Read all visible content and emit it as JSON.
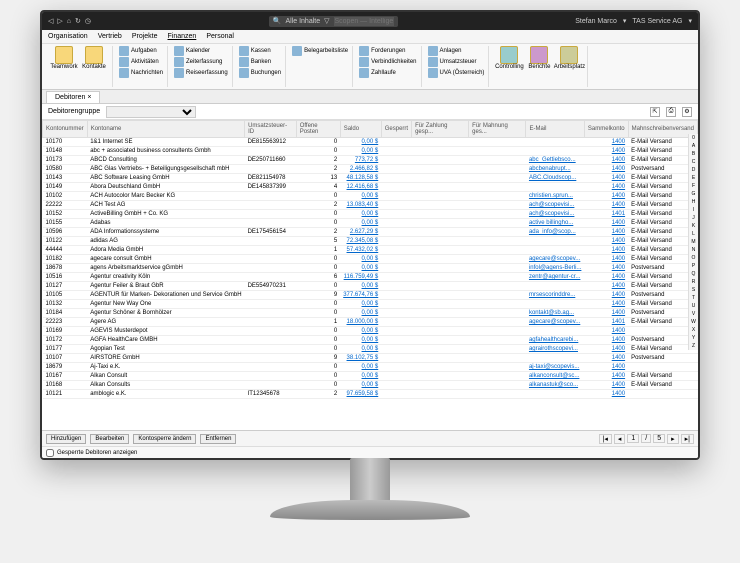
{
  "titlebar": {
    "search_prefix": "Alle Inhalte",
    "search_label": "Scopen — Intelligentes Suchfeld",
    "user": "Stefan Marco",
    "company": "TAS Service AG"
  },
  "menu": {
    "items": [
      "Organisation",
      "Vertrieb",
      "Projekte",
      "Finanzen",
      "Personal"
    ]
  },
  "ribbon": {
    "g1": {
      "big": [
        {
          "l": "Teamwork"
        },
        {
          "l": "Kontakte"
        }
      ],
      "small": [
        {
          "l": "Aufgaben"
        },
        {
          "l": "Aktivitäten"
        },
        {
          "l": "Nachrichten"
        }
      ]
    },
    "g2": {
      "small": [
        {
          "l": "Kalender"
        },
        {
          "l": "Zeiterfassung"
        },
        {
          "l": "Reiseerfassung"
        }
      ]
    },
    "g3": {
      "small": [
        {
          "l": "Kassen"
        },
        {
          "l": "Banken"
        },
        {
          "l": "Buchungen"
        }
      ]
    },
    "g4": {
      "small": [
        {
          "l": "Belegarbeitsliste"
        }
      ]
    },
    "g5": {
      "small": [
        {
          "l": "Forderungen"
        },
        {
          "l": "Verbindlichkeiten"
        },
        {
          "l": "Zahllaufe"
        }
      ]
    },
    "g6": {
      "small": [
        {
          "l": "Anlagen"
        },
        {
          "l": "Umsatzsteuer"
        },
        {
          "l": "UVA (Österreich)"
        }
      ]
    },
    "g7": {
      "big": [
        {
          "l": "Controlling"
        },
        {
          "l": "Berichte"
        },
        {
          "l": "Arbeitsplatz"
        }
      ]
    }
  },
  "tab_label": "Debitoren",
  "filter": {
    "label": "Debitorengruppe"
  },
  "columns": [
    "Kontonummer",
    "Kontoname",
    "Umsatzsteuer-ID",
    "Offene Posten",
    "Saldo",
    "Gesperrt",
    "Für Zahlung gesp...",
    "Für Mahnung ges...",
    "E-Mail",
    "Sammelkonto",
    "Mahnschreibenversand"
  ],
  "rows": [
    {
      "n": "10170",
      "name": "1&1 Internet SE",
      "vat": "DE815563912",
      "op": "0",
      "saldo": "0,00 $",
      "email": "",
      "sk": "1400",
      "mv": "E-Mail Versand"
    },
    {
      "n": "10148",
      "name": "abc + associated business consultents Gmbh",
      "vat": "",
      "op": "0",
      "saldo": "0,00 $",
      "email": "",
      "sk": "1400",
      "mv": "E-Mail Versand"
    },
    {
      "n": "10173",
      "name": "ABCD Consulting",
      "vat": "DE250711660",
      "op": "2",
      "saldo": "773,72 $",
      "email": "abc_Gettiebsco...",
      "sk": "1400",
      "mv": "E-Mail Versand"
    },
    {
      "n": "10580",
      "name": "ABC Glas Vertriebs- + Beteiligungsgesellschaft mbH",
      "vat": "",
      "op": "2",
      "saldo": "2.466,82 $",
      "email": "abcbenabrupt...",
      "sk": "1400",
      "mv": "Postversand"
    },
    {
      "n": "10143",
      "name": "ABC Software Leasing GmbH",
      "vat": "DE821154978",
      "op": "13",
      "saldo": "48.128,58 $",
      "email": "ABC.Cloudscop...",
      "sk": "1400",
      "mv": "E-Mail Versand"
    },
    {
      "n": "10149",
      "name": "Abora Deutschland GmbH",
      "vat": "DE145837399",
      "op": "4",
      "saldo": "12.416,68 $",
      "email": "",
      "sk": "1400",
      "mv": "E-Mail Versand"
    },
    {
      "n": "10102",
      "name": "ACH Autocolor Marc Becker KG",
      "vat": "",
      "op": "0",
      "saldo": "0,00 $",
      "email": "christien.sprun...",
      "sk": "1400",
      "mv": "E-Mail Versand"
    },
    {
      "n": "22222",
      "name": "ACH Test AG",
      "vat": "",
      "op": "2",
      "saldo": "13.083,40 $",
      "email": "ach@scopevisi...",
      "sk": "1400",
      "mv": "E-Mail Versand"
    },
    {
      "n": "10152",
      "name": "ActiveBilling GmbH + Co. KG",
      "vat": "",
      "op": "0",
      "saldo": "0,00 $",
      "email": "ach@scopevisi...",
      "sk": "1401",
      "mv": "E-Mail Versand"
    },
    {
      "n": "10155",
      "name": "Adabas",
      "vat": "",
      "op": "0",
      "saldo": "0,00 $",
      "email": "active billingho...",
      "sk": "1400",
      "mv": "E-Mail Versand"
    },
    {
      "n": "10596",
      "name": "ADA Informationssysteme",
      "vat": "DE175456154",
      "op": "2",
      "saldo": "2.627,29 $",
      "email": "ada_info@scop...",
      "sk": "1400",
      "mv": "E-Mail Versand"
    },
    {
      "n": "10122",
      "name": "adidas AG",
      "vat": "",
      "op": "5",
      "saldo": "72.345,08 $",
      "email": "",
      "sk": "1400",
      "mv": "E-Mail Versand"
    },
    {
      "n": "44444",
      "name": "Adora Media GmbH",
      "vat": "",
      "op": "1",
      "saldo": "57.432,02 $",
      "email": "",
      "sk": "1400",
      "mv": "E-Mail Versand"
    },
    {
      "n": "10182",
      "name": "agecare consult GmbH",
      "vat": "",
      "op": "0",
      "saldo": "0,00 $",
      "email": "agecare@scopev...",
      "sk": "1400",
      "mv": "E-Mail Versand"
    },
    {
      "n": "18678",
      "name": "agens Arbeitsmarktservice gGmbH",
      "vat": "",
      "op": "0",
      "saldo": "0,00 $",
      "email": "infol@agens-Berli...",
      "sk": "1400",
      "mv": "Postversand"
    },
    {
      "n": "10516",
      "name": "Agentur creativity Köln",
      "vat": "",
      "op": "6",
      "saldo": "116.759,49 $",
      "email": "zentr@agentur-cr...",
      "sk": "1400",
      "mv": "E-Mail Versand"
    },
    {
      "n": "10127",
      "name": "Agentur Feiler & Braut GbR",
      "vat": "DE554970231",
      "op": "0",
      "saldo": "0,00 $",
      "email": "",
      "sk": "1400",
      "mv": "E-Mail Versand"
    },
    {
      "n": "10105",
      "name": "AGENTUR für Marken- Dekorationen und Service GmbH",
      "vat": "",
      "op": "9",
      "saldo": "377.674,76 $",
      "email": "mrsescorinddre...",
      "sk": "1400",
      "mv": "Postversand"
    },
    {
      "n": "10132",
      "name": "Agentur New Way One",
      "vat": "",
      "op": "0",
      "saldo": "0,00 $",
      "email": "",
      "sk": "1400",
      "mv": "E-Mail Versand"
    },
    {
      "n": "10184",
      "name": "Agentur Schöner & Bornhölzer",
      "vat": "",
      "op": "0",
      "saldo": "0,00 $",
      "email": "kontakt@sb.ag...",
      "sk": "1400",
      "mv": "Postversand"
    },
    {
      "n": "22223",
      "name": "Agere AG",
      "vat": "",
      "op": "1",
      "saldo": "18.000,00 $",
      "email": "agecare@scopev...",
      "sk": "1401",
      "mv": "E-Mail Versand"
    },
    {
      "n": "10169",
      "name": "AGEVIS Musterdepot",
      "vat": "",
      "op": "0",
      "saldo": "0,00 $",
      "email": "",
      "sk": "1400",
      "mv": ""
    },
    {
      "n": "10172",
      "name": "AGFA HealthCare GMBH",
      "vat": "",
      "op": "0",
      "saldo": "0,00 $",
      "email": "agfahealthcarebi...",
      "sk": "1400",
      "mv": "Postversand"
    },
    {
      "n": "10177",
      "name": "Agopian Test",
      "vat": "",
      "op": "0",
      "saldo": "0,00 $",
      "email": "agrairothscopevi...",
      "sk": "1400",
      "mv": "E-Mail Versand"
    },
    {
      "n": "10107",
      "name": "AIRSTORE GmbH",
      "vat": "",
      "op": "9",
      "saldo": "38.102,75 $",
      "email": "",
      "sk": "1400",
      "mv": "Postversand"
    },
    {
      "n": "18679",
      "name": "Aj-Taxi e.K.",
      "vat": "",
      "op": "0",
      "saldo": "0,00 $",
      "email": "aj-taxi@scopevis...",
      "sk": "1400",
      "mv": ""
    },
    {
      "n": "10167",
      "name": "Alkan Consult",
      "vat": "",
      "op": "0",
      "saldo": "0,00 $",
      "email": "alkanconsult@sc...",
      "sk": "1400",
      "mv": "E-Mail Versand"
    },
    {
      "n": "10168",
      "name": "Alkan Consults",
      "vat": "",
      "op": "0",
      "saldo": "0,00 $",
      "email": "alkanastuk@sco...",
      "sk": "1400",
      "mv": "E-Mail Versand"
    },
    {
      "n": "10121",
      "name": "amblogic e.K.",
      "vat": "IT12345678",
      "op": "2",
      "saldo": "97.659,58 $",
      "email": "",
      "sk": "1400",
      "mv": ""
    }
  ],
  "alpha": [
    "0",
    "A",
    "B",
    "C",
    "D",
    "E",
    "F",
    "G",
    "H",
    "I",
    "J",
    "K",
    "L",
    "M",
    "N",
    "O",
    "P",
    "Q",
    "R",
    "S",
    "T",
    "U",
    "V",
    "W",
    "X",
    "Y",
    "Z"
  ],
  "footer": {
    "buttons": [
      "Hinzufügen",
      "Bearbeiten",
      "Kontosperre ändern",
      "Entfernen"
    ],
    "pager": {
      "current": "1",
      "total": "5"
    },
    "checkbox": "Gesperrte Debitoren anzeigen"
  }
}
